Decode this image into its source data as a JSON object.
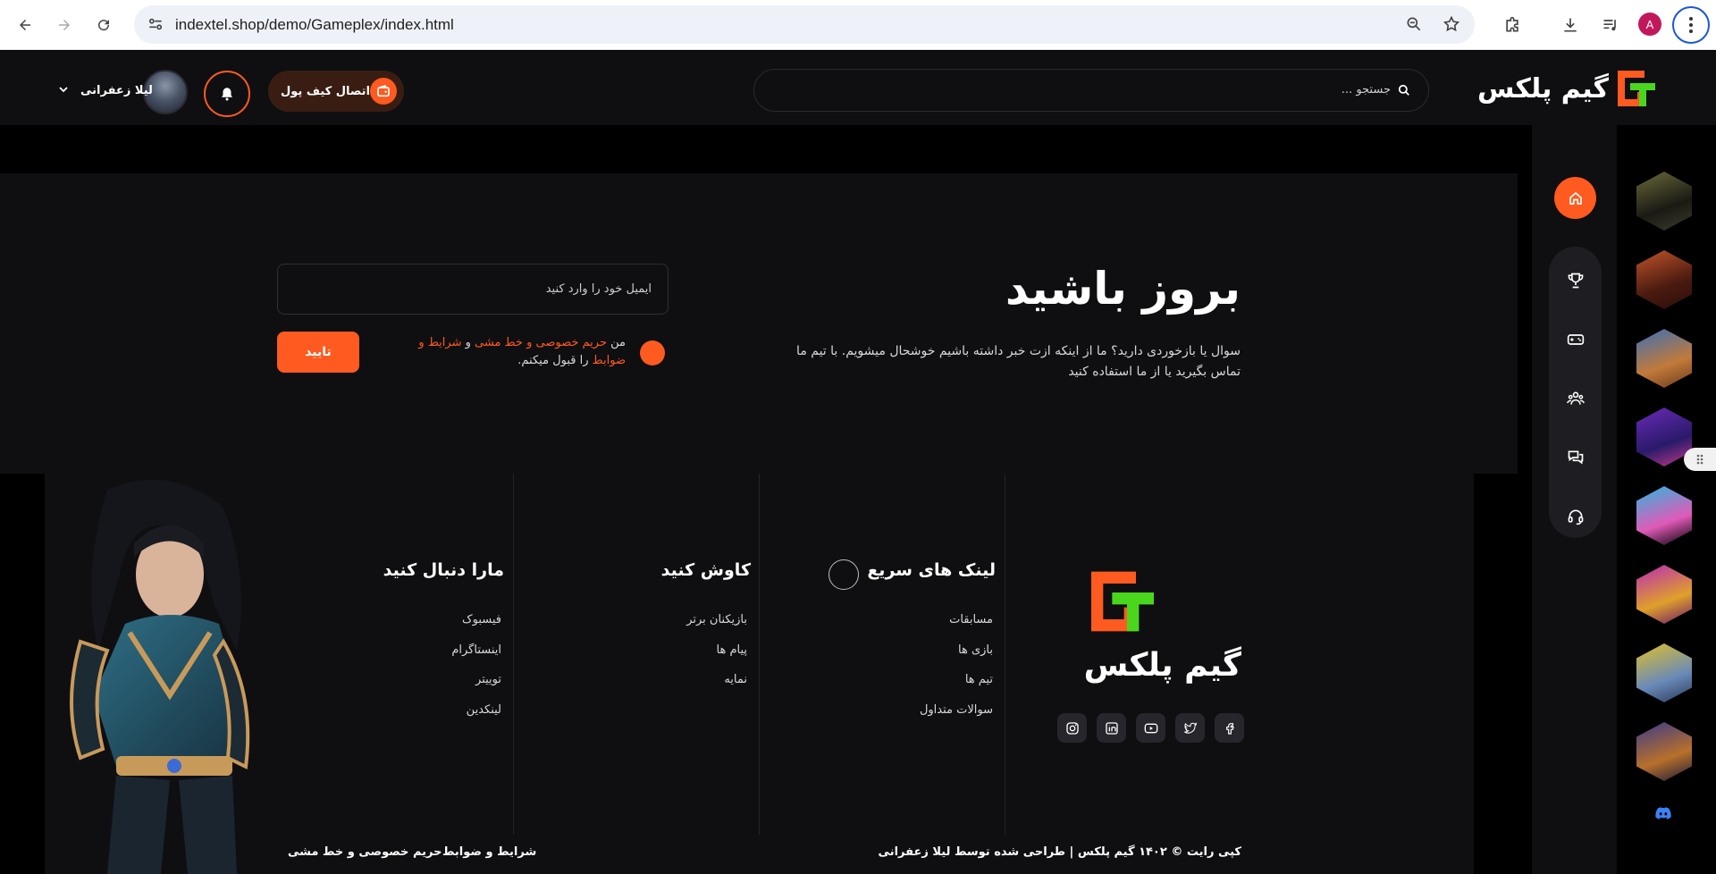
{
  "browser": {
    "url": "indextel.shop/demo/Gameplex/index.html",
    "profile_initial": "A"
  },
  "header": {
    "logo_text": "گیم پلکس",
    "search_placeholder": "جستجو ...",
    "wallet_label": "اتصال کیف پول",
    "user_name": "لیلا زعفرانی"
  },
  "newsletter": {
    "title": "بروز باشید",
    "description": "سوال یا بازخوردی دارید؟ ما از اینکه ازت خبر داشته باشیم خوشحال میشویم. با تیم ما تماس بگیرید یا از ما استفاده کنید",
    "email_placeholder": "ایمیل خود را وارد کنید",
    "agree_prefix": "من",
    "privacy_link": "حریم خصوصی و خط مشی",
    "agree_and": "و",
    "terms_link": "شرایط و ضوابط",
    "agree_suffix": "را قبول میکنم.",
    "submit_label": "تایید"
  },
  "footer": {
    "logo_text": "گیم پلکس",
    "quick_links": {
      "title": "لینک های سریع",
      "items": [
        "مسابقات",
        "بازی ها",
        "تیم ها",
        "سوالات متداول"
      ]
    },
    "explore": {
      "title": "کاوش کنید",
      "items": [
        "بازیکنان برتر",
        "پیام ها",
        "نمایه"
      ]
    },
    "follow": {
      "title": "مارا دنبال کنید",
      "items": [
        "فیسبوک",
        "اینستاگرام",
        "توییتر",
        "لینکدین"
      ]
    },
    "copyright": "کپی رایت © ۱۴۰۲ گیم پلکس | طراحی شده توسط لیلا زعفرانی",
    "terms": "شرایط و ضوابط",
    "privacy": "حریم خصوصی و خط مشی"
  },
  "colors": {
    "accent": "#ff5a1f",
    "logo_green": "#4bd61e",
    "bg_dark": "#0f0f12"
  },
  "games": [
    "call-of-duty",
    "dota",
    "clash",
    "fortnite",
    "brawl",
    "party",
    "apex",
    "valorant"
  ]
}
